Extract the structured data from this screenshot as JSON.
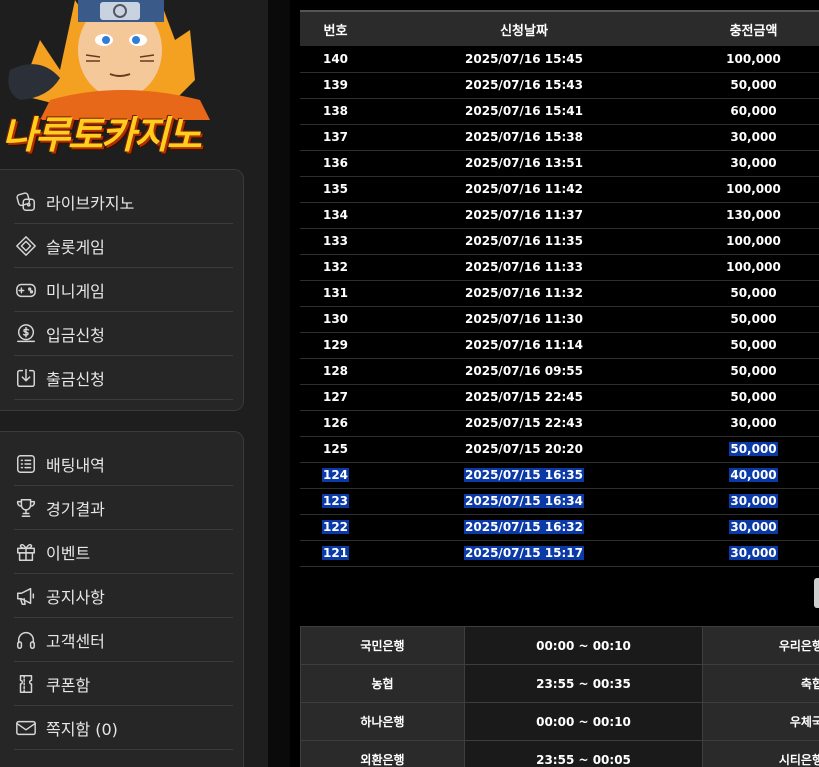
{
  "logo": {
    "text": "나루토카지노"
  },
  "menu_primary": [
    {
      "label": "라이브카지노",
      "icon": "casino-chip-icon"
    },
    {
      "label": "슬롯게임",
      "icon": "diamond-icon"
    },
    {
      "label": "미니게임",
      "icon": "gamepad-icon"
    },
    {
      "label": "입금신청",
      "icon": "dollar-coin-icon"
    },
    {
      "label": "출금신청",
      "icon": "download-icon"
    }
  ],
  "menu_secondary": [
    {
      "label": "배팅내역",
      "icon": "list-icon"
    },
    {
      "label": "경기결과",
      "icon": "trophy-icon"
    },
    {
      "label": "이벤트",
      "icon": "gift-icon"
    },
    {
      "label": "공지사항",
      "icon": "megaphone-icon"
    },
    {
      "label": "고객센터",
      "icon": "headset-icon"
    },
    {
      "label": "쿠폰함",
      "icon": "coupon-icon"
    },
    {
      "label": "쪽지함 (0)",
      "icon": "mail-icon"
    }
  ],
  "deposit_table": {
    "headers": [
      "번호",
      "신청날짜",
      "충전금액"
    ],
    "rows": [
      {
        "no": "140",
        "date": "2025/07/16 15:45",
        "amount": "100,000"
      },
      {
        "no": "139",
        "date": "2025/07/16 15:43",
        "amount": "50,000"
      },
      {
        "no": "138",
        "date": "2025/07/16 15:41",
        "amount": "60,000"
      },
      {
        "no": "137",
        "date": "2025/07/16 15:38",
        "amount": "30,000"
      },
      {
        "no": "136",
        "date": "2025/07/16 13:51",
        "amount": "30,000"
      },
      {
        "no": "135",
        "date": "2025/07/16 11:42",
        "amount": "100,000"
      },
      {
        "no": "134",
        "date": "2025/07/16 11:37",
        "amount": "130,000"
      },
      {
        "no": "133",
        "date": "2025/07/16 11:35",
        "amount": "100,000"
      },
      {
        "no": "132",
        "date": "2025/07/16 11:33",
        "amount": "100,000"
      },
      {
        "no": "131",
        "date": "2025/07/16 11:32",
        "amount": "50,000"
      },
      {
        "no": "130",
        "date": "2025/07/16 11:30",
        "amount": "50,000"
      },
      {
        "no": "129",
        "date": "2025/07/16 11:14",
        "amount": "50,000"
      },
      {
        "no": "128",
        "date": "2025/07/16 09:55",
        "amount": "50,000"
      },
      {
        "no": "127",
        "date": "2025/07/15 22:45",
        "amount": "50,000"
      },
      {
        "no": "126",
        "date": "2025/07/15 22:43",
        "amount": "30,000"
      },
      {
        "no": "125",
        "date": "2025/07/15 20:20",
        "amount": "50,000"
      },
      {
        "no": "124",
        "date": "2025/07/15 16:35",
        "amount": "40,000"
      },
      {
        "no": "123",
        "date": "2025/07/15 16:34",
        "amount": "30,000"
      },
      {
        "no": "122",
        "date": "2025/07/15 16:32",
        "amount": "30,000"
      },
      {
        "no": "121",
        "date": "2025/07/15 15:17",
        "amount": "30,000"
      }
    ]
  },
  "bank_hours": [
    {
      "bank": "국민은행",
      "hours": "00:00 ~ 00:10",
      "bank2": "우리은행"
    },
    {
      "bank": "농협",
      "hours": "23:55 ~ 00:35",
      "bank2": "축협"
    },
    {
      "bank": "하나은행",
      "hours": "00:00 ~ 00:10",
      "bank2": "우체국"
    },
    {
      "bank": "외환은행",
      "hours": "23:55 ~ 00:05",
      "bank2": "시티은행"
    }
  ],
  "colors": {
    "selection": "#0b3aa6",
    "logo": "#ffce1f",
    "sidebar": "#1e1e1e"
  }
}
